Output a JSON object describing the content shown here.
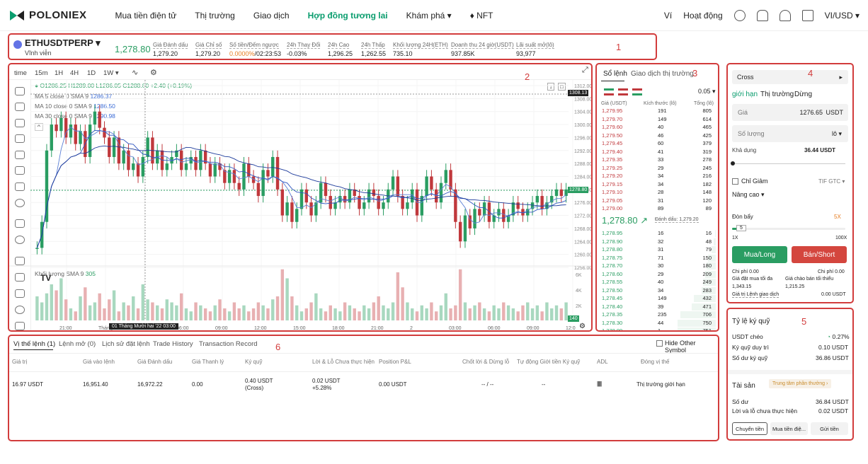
{
  "nav": {
    "brand": "POLONIEX",
    "links": [
      "Mua tiền điện tử",
      "Thị trường",
      "Giao dịch",
      "Hợp đồng tương lai",
      "Khám phá ▾",
      "♦ NFT"
    ],
    "wallet": "Ví",
    "activity": "Hoạt động",
    "currency": "VI/USD ▾"
  },
  "ticker": {
    "symbol": "ETHUSDTPERP",
    "sub": "Vĩnh viễn",
    "price": "1,278.80",
    "stats": [
      {
        "l": "Giá Đánh dấu",
        "v": "1,279.20"
      },
      {
        "l": "Giá Chỉ số",
        "v": "1,279.20"
      },
      {
        "l": "Số tiền/Đếm ngược",
        "v": "0.0000%",
        "v2": "/02:23:53"
      },
      {
        "l": "24h Thay Đổi",
        "v": "-0.03%"
      },
      {
        "l": "24h Cao",
        "v": "1,296.25"
      },
      {
        "l": "24h Thấp",
        "v": "1,262.55"
      },
      {
        "l": "Khối lượng 24H(ETH)",
        "v": "735.10"
      },
      {
        "l": "Doanh thu 24 giờ(USDT)",
        "v": "937.85K"
      },
      {
        "l": "Lãi suất mở(lô)",
        "v": "93,977"
      }
    ]
  },
  "labels": {
    "b1": "1",
    "b2": "2",
    "b3": "3",
    "b4": "4",
    "b5": "5",
    "b6": "6"
  },
  "chart": {
    "toolbar": [
      "time",
      "15m",
      "1H",
      "4H",
      "1D",
      "1W ▾"
    ],
    "ohlc": "O1286.25 H1289.00 L1286.05 C1288.60 +2.40 (+0.19%)",
    "ma": [
      {
        "l": "MA 5 close 0 SMA 9",
        "v": "1286.37"
      },
      {
        "l": "MA 10 close 0 SMA 9",
        "v": "1286.50"
      },
      {
        "l": "MA 30 close 0 SMA 9",
        "v": "1290.98"
      }
    ],
    "vol_label": "Khối lượng SMA 9",
    "vol_val": "305",
    "prices": [
      "1312.00",
      "1308.00",
      "1304.00",
      "1300.00",
      "1296.00",
      "1292.00",
      "1288.00",
      "1284.00",
      "1280.00",
      "1276.00",
      "1272.00",
      "1268.00",
      "1264.00",
      "1260.00",
      "1256.00"
    ],
    "vol_ticks": [
      "6K",
      "4K",
      "2K"
    ],
    "cur_price": "1308.13",
    "last_price": "1278.80",
    "vol_badge": "140",
    "times": [
      "21:00",
      "Tháng M",
      "03:00",
      "06:00",
      "09:00",
      "12:00",
      "15:00",
      "18:00",
      "21:00",
      "2",
      "03:00",
      "06:00",
      "09:00",
      "12:0"
    ],
    "crosshair": "01 Tháng Mười hai '22  03:00",
    "series": [
      1262,
      1270,
      1292,
      1300,
      1298,
      1302,
      1296,
      1300,
      1294,
      1298,
      1290,
      1300,
      1304,
      1299,
      1296,
      1290,
      1296,
      1288,
      1292,
      1286,
      1288,
      1284,
      1290,
      1296,
      1288,
      1292,
      1286,
      1288,
      1290,
      1292,
      1286,
      1288,
      1290,
      1286,
      1292,
      1288,
      1284,
      1288,
      1286,
      1282,
      1286,
      1282,
      1280,
      1288,
      1284,
      1282,
      1278,
      1286,
      1284,
      1290,
      1280,
      1272,
      1276,
      1270,
      1274,
      1280,
      1276,
      1272,
      1276,
      1282,
      1278,
      1274,
      1276,
      1278,
      1276,
      1280,
      1278,
      1274,
      1276,
      1280,
      1278,
      1274,
      1276,
      1280,
      1284,
      1278,
      1274,
      1276,
      1280,
      1272,
      1278,
      1284,
      1280,
      1276,
      1282,
      1286,
      1280,
      1270,
      1264,
      1272,
      1268,
      1274,
      1272,
      1276,
      1270,
      1272,
      1274,
      1270,
      1272,
      1276,
      1274,
      1272,
      1274,
      1276,
      1278,
      1274,
      1276,
      1278,
      1280,
      1278,
      1280
    ],
    "volumes": [
      40,
      30,
      45,
      60,
      50,
      70,
      35,
      20,
      15,
      40,
      55,
      25,
      30,
      45,
      20,
      35,
      50,
      15,
      30,
      25,
      40,
      20,
      60,
      35,
      30,
      25,
      20,
      35,
      30,
      25,
      45,
      20,
      15,
      30,
      25,
      20,
      15,
      25,
      35,
      20,
      15,
      30,
      20,
      25,
      15,
      20,
      30,
      25,
      20,
      35,
      40,
      85,
      70,
      40,
      25,
      15,
      20,
      30,
      45,
      20,
      15,
      25,
      20,
      15,
      30,
      25,
      20,
      15,
      25,
      20,
      30,
      40,
      25,
      20,
      30,
      80,
      55,
      30,
      20,
      15,
      25,
      20,
      30,
      15,
      25,
      45,
      20,
      25,
      85,
      30,
      20,
      25,
      30,
      20,
      15,
      25,
      20,
      30,
      25,
      20,
      15,
      25,
      30,
      20,
      25,
      15,
      30,
      20,
      25,
      20,
      30
    ]
  },
  "orderbook": {
    "tabs": [
      "Sổ lệnh",
      "Giao dịch thị trường"
    ],
    "step": "0.05 ▾",
    "cols": [
      "Giá (USDT)",
      "Kích thước (lô)",
      "Tổng (lô)"
    ],
    "asks": [
      [
        "1,279.95",
        "191",
        "805"
      ],
      [
        "1,279.70",
        "149",
        "614"
      ],
      [
        "1,279.60",
        "40",
        "465"
      ],
      [
        "1,279.50",
        "46",
        "425"
      ],
      [
        "1,279.45",
        "60",
        "379"
      ],
      [
        "1,279.40",
        "41",
        "319"
      ],
      [
        "1,279.35",
        "33",
        "278"
      ],
      [
        "1,279.25",
        "29",
        "245"
      ],
      [
        "1,279.20",
        "34",
        "216"
      ],
      [
        "1,279.15",
        "34",
        "182"
      ],
      [
        "1,279.10",
        "28",
        "148"
      ],
      [
        "1,279.05",
        "31",
        "120"
      ],
      [
        "1,279.00",
        "89",
        "89"
      ]
    ],
    "mid": "1,278.80 ↗",
    "mark": "Đánh dấu: 1,279.20",
    "bids": [
      [
        "1,278.95",
        "16",
        "16"
      ],
      [
        "1,278.90",
        "32",
        "48"
      ],
      [
        "1,278.80",
        "31",
        "79"
      ],
      [
        "1,278.75",
        "71",
        "150"
      ],
      [
        "1,278.70",
        "30",
        "180"
      ],
      [
        "1,278.60",
        "29",
        "209"
      ],
      [
        "1,278.55",
        "40",
        "249"
      ],
      [
        "1,278.50",
        "34",
        "283"
      ],
      [
        "1,278.45",
        "149",
        "432"
      ],
      [
        "1,278.40",
        "39",
        "471"
      ],
      [
        "1,278.35",
        "235",
        "706"
      ],
      [
        "1,278.30",
        "44",
        "750"
      ],
      [
        "1,278.00",
        "1",
        "751"
      ]
    ]
  },
  "order": {
    "mode": "Cross",
    "tabs": [
      "giới hạn",
      "Thị trường",
      "Dừng"
    ],
    "price_label": "Giá",
    "price_val": "1276.65",
    "price_unit": "USDT",
    "qty_label": "Số lượng",
    "qty_unit": "lô ▾",
    "avail_label": "Khả dụng",
    "avail_val": "36.44 USDT",
    "reduce": "Chỉ Giảm",
    "tif": "TIF",
    "gtc": "GTC ▾",
    "adv": "Nâng cao ▾",
    "lev_label": "Đòn bẩy",
    "lev_val": "5X",
    "lev_input": "5",
    "lev_min": "1X",
    "lev_max": "100X",
    "buy": "Mua/Long",
    "sell": "Bán/Short",
    "cost_l": "Chi phí 0.00",
    "cost_r": "Chi phí 0.00",
    "max_buy": "Giá đặt mua tối đa",
    "max_buy_v": "1,343.15",
    "min_sell": "Giá chào bán tối thiểu",
    "min_sell_v": "1,215.25",
    "order_val": "Giá trị Lệnh giao dịch",
    "order_val_v": "0.00 USDT",
    "lev_frac": 0.05
  },
  "margin": {
    "title": "Tỷ lệ ký quỹ",
    "rows": [
      {
        "l": "USDT chéo",
        "v": "0.27%"
      },
      {
        "l": "Ký quỹ duy trì",
        "v": "0.10 USDT"
      },
      {
        "l": "Số dư ký quỹ",
        "v": "36.86 USDT"
      }
    ],
    "assets": "Tài sản",
    "reward": "Trung tâm phần thưởng  ›",
    "rows2": [
      {
        "l": "Số dư",
        "v": "36.84 USDT"
      },
      {
        "l": "Lời và lỗ chưa thực hiện",
        "v": "0.02 USDT"
      }
    ],
    "btns": [
      "Chuyển tiền",
      "Mua tiền điệ...",
      "Gửi tiền"
    ]
  },
  "positions": {
    "tabs": [
      "Vị thế lệnh (1)",
      "Lệnh mở (0)",
      "Lịch sử đặt lệnh",
      "Trade History",
      "Transaction Record"
    ],
    "hide": "Hide Other Symbol",
    "cols": [
      "Giá trị",
      "Giá vào lệnh",
      "Giá Đánh dấu",
      "Giá Thanh lý",
      "Ký quỹ",
      "Lời & Lỗ Chưa thực hiện",
      "Position P&L",
      "Chốt lời & Dừng lỗ",
      "Tự động Giới tiền Ký quỹ",
      "ADL",
      "Đóng vị thế"
    ],
    "row": [
      "16.97 USDT",
      "16,951.40",
      "16,972.22",
      "0.00",
      "0.40 USDT",
      "(Cross)",
      "0.02 USDT",
      "+5.28%",
      "0.00 USDT",
      "-- / --",
      "--",
      "Thị trường",
      "giới hạn"
    ]
  }
}
